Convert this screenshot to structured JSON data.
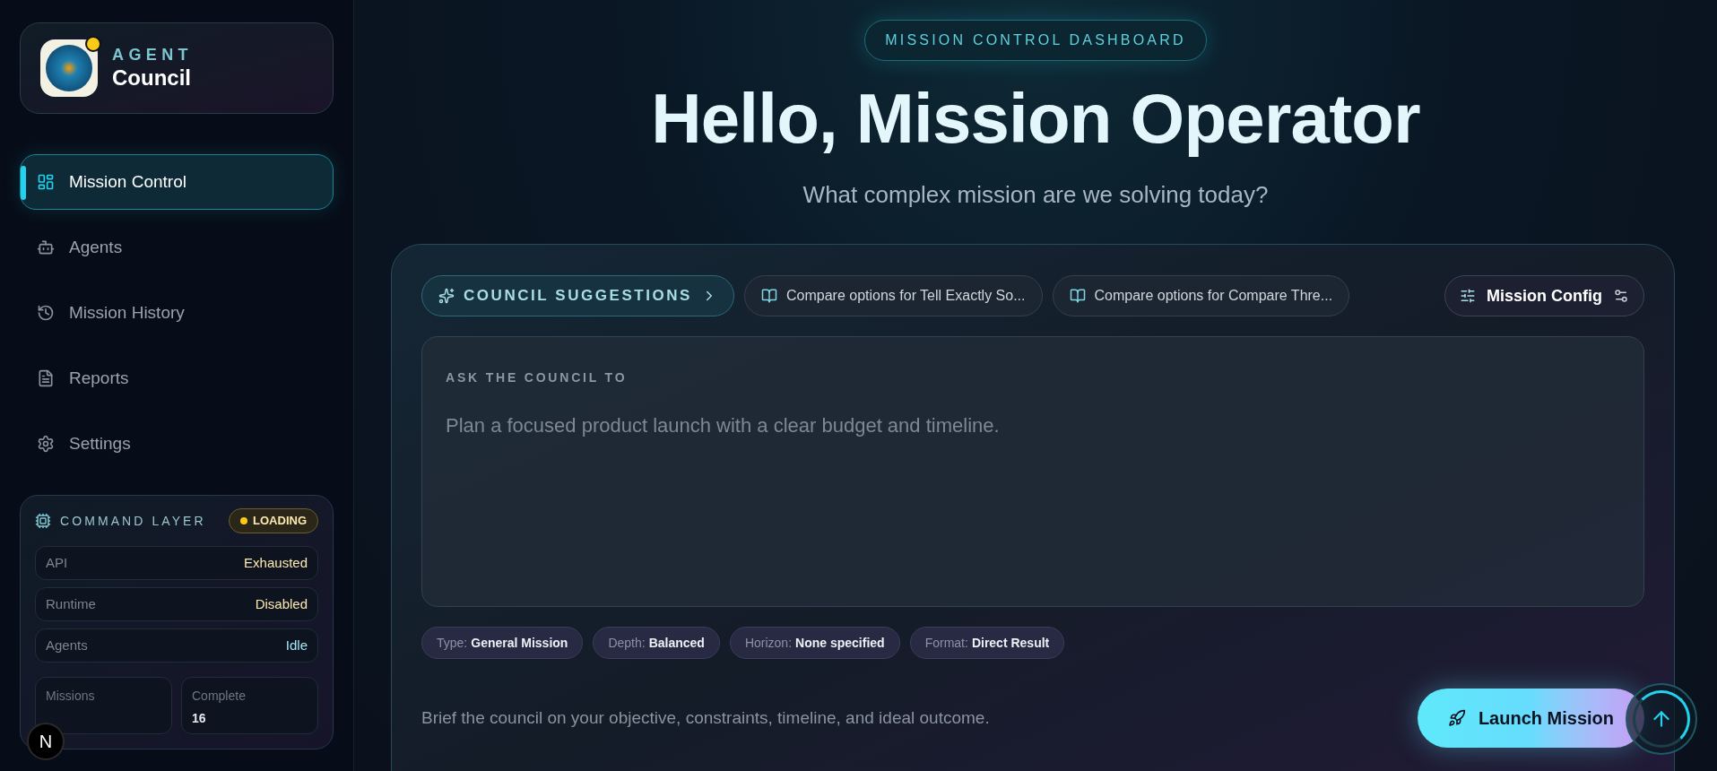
{
  "brand": {
    "eyebrow": "AGENT",
    "name": "Council",
    "color": "#facc15"
  },
  "nav": [
    {
      "label": "Mission Control",
      "selected": true
    },
    {
      "label": "Agents",
      "selected": false
    },
    {
      "label": "Mission History",
      "selected": false
    },
    {
      "label": "Reports",
      "selected": false
    },
    {
      "label": "Settings",
      "selected": false
    }
  ],
  "command_layer": {
    "title": "COMMAND LAYER",
    "status": {
      "label": "LOADING",
      "color": "#facc15"
    },
    "rows": [
      {
        "label": "API",
        "value": "Exhausted",
        "color": "#fde9b0"
      },
      {
        "label": "Runtime",
        "value": "Disabled",
        "color": "#fde9b0"
      },
      {
        "label": "Agents",
        "value": "Idle",
        "color": "#a5e8f5"
      }
    ],
    "stats": [
      {
        "label": "Missions"
      },
      {
        "label": "Complete",
        "value": "16"
      }
    ]
  },
  "dev_badge": {
    "label": "N"
  },
  "header": {
    "pill": "MISSION CONTROL DASHBOARD",
    "title": "Hello, Mission Operator",
    "subtitle": "What complex mission are we solving today?"
  },
  "composer": {
    "suggestions_button": "COUNCIL SUGGESTIONS",
    "suggestions": [
      "Compare options for Tell Exactly So...",
      "Compare options for Compare Thre..."
    ],
    "config_button": "Mission Config",
    "prompt": {
      "label": "ASK THE COUNCIL TO",
      "placeholder": "Plan a focused product launch with a clear budget and timeline."
    },
    "tags": [
      {
        "label": "Type:",
        "value": "General Mission"
      },
      {
        "label": "Depth:",
        "value": "Balanced"
      },
      {
        "label": "Horizon:",
        "value": "None specified"
      },
      {
        "label": "Format:",
        "value": "Direct Result"
      }
    ],
    "hint": "Brief the council on your objective, constraints, timeline, and ideal outcome.",
    "launch_button": "Launch Mission"
  }
}
